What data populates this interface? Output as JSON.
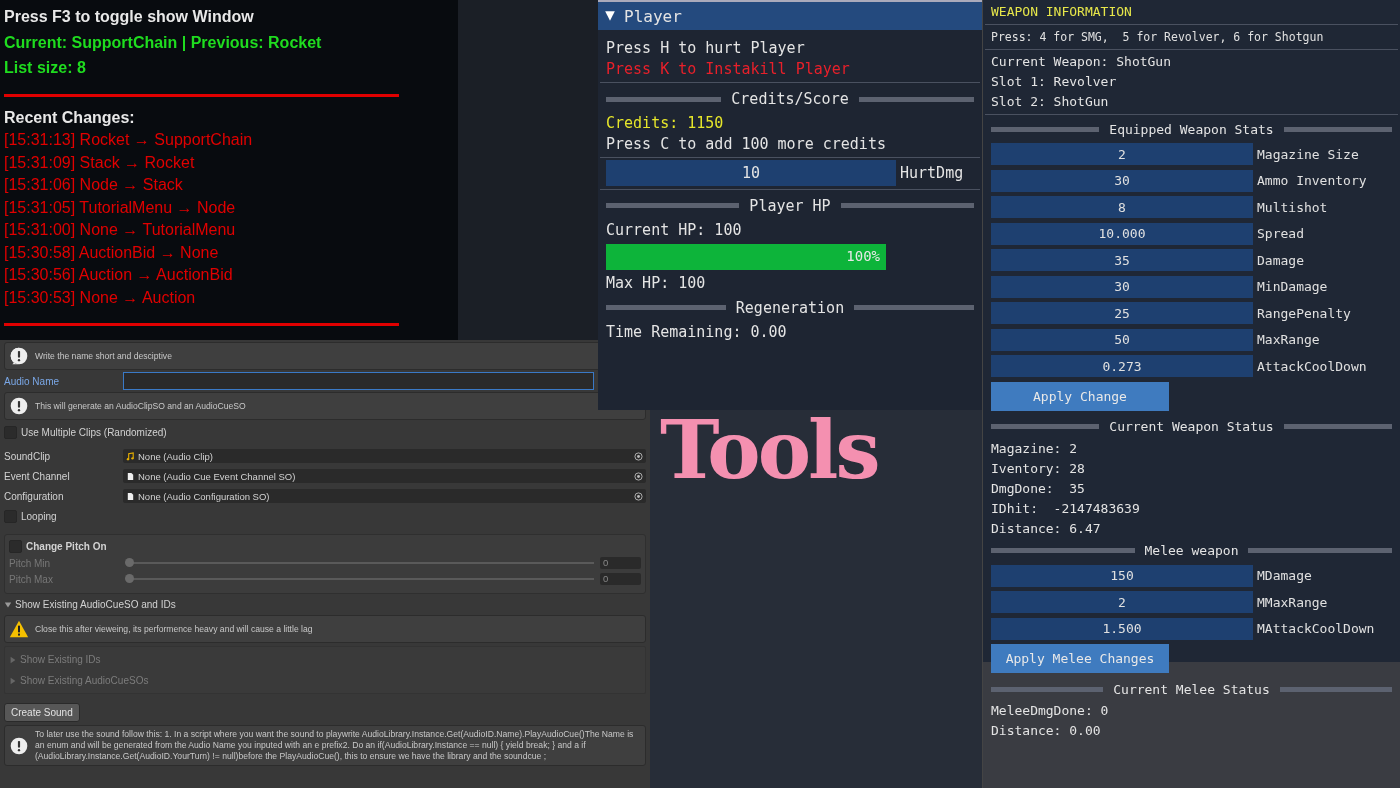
{
  "debug_overlay": {
    "title": "Press F3 to toggle show Window",
    "state_line": "Current: SupportChain | Previous: Rocket",
    "list_size": "List size: 8",
    "recent_heading": "Recent Changes:",
    "changes": [
      "[15:31:13] Rocket → SupportChain",
      "[15:31:09] Stack → Rocket",
      "[15:31:06] Node → Stack",
      "[15:31:05] TutorialMenu → Node",
      "[15:31:00] None → TutorialMenu",
      "[15:30:58] AuctionBid → None",
      "[15:30:56] Auction → AuctionBid",
      "[15:30:53] None → Auction"
    ]
  },
  "inspector": {
    "help_top": "Write the name short and desciptive",
    "audio_name_label": "Audio Name",
    "help_generate": "This will generate an AudioClipSO and an AudioCueSO",
    "multiple_clips": {
      "label": "Use Multiple Clips (Randomized)",
      "checked": false
    },
    "object_fields": [
      {
        "label": "SoundClip",
        "value": "None (Audio Clip)",
        "kind": "audio"
      },
      {
        "label": "Event Channel",
        "value": "None (Audio Cue Event Channel SO)",
        "kind": "asset"
      },
      {
        "label": "Configuration",
        "value": "None (Audio Configuration SO)",
        "kind": "asset"
      }
    ],
    "looping": {
      "label": "Looping",
      "checked": false
    },
    "pitch": {
      "label": "Change Pitch On",
      "checked": false,
      "sliders": [
        {
          "label": "Pitch Min",
          "level": 0,
          "value": "0"
        },
        {
          "label": "Pitch Max",
          "level": 0,
          "value": "0"
        }
      ]
    },
    "foldout": {
      "label": "Show Existing AudioCueSO and IDs",
      "expanded": true,
      "warning": "Close this after vieweing, its performence heavy and will cause a little lag",
      "children": [
        {
          "label": "Show Existing IDs",
          "expanded": false
        },
        {
          "label": "Show Existing AudioCueSOs",
          "expanded": false
        }
      ]
    },
    "create_button": "Create Sound",
    "help_usage": "To later use the sound follow this: 1. In a script where you want the sound to playwrite AudioLibrary.Instance.Get(AudioID.Name).PlayAudioCue()The Name is an enum and will be generated from the Audio Name you inputed with an e prefix2. Do an if(AudioLibrary.Instance == null) { yield break; } and a if (AudioLibrary.Instance.Get(AudioID.YourTurn) != null)before the PlayAudioCue(), this to ensure we have the library and the soundcue ;"
  },
  "player": {
    "title": "Player",
    "expanded": true,
    "items": [
      {
        "kind": "text",
        "text": "Press H to hurt Player"
      },
      {
        "kind": "alert",
        "text": "Press K to Instakill Player"
      },
      {
        "kind": "rule"
      },
      {
        "kind": "heading",
        "text": "Credits/Score"
      },
      {
        "kind": "credit",
        "text": "Credits: 1150"
      },
      {
        "kind": "text",
        "text": "Press C to add 100 more credits"
      },
      {
        "kind": "rule"
      },
      {
        "kind": "input",
        "value": "10",
        "label": "HurtDmg"
      },
      {
        "kind": "rule"
      },
      {
        "kind": "heading",
        "text": "Player HP"
      },
      {
        "kind": "text",
        "text": "Current HP: 100"
      },
      {
        "kind": "progress",
        "level": 1,
        "reading": "100%"
      },
      {
        "kind": "text",
        "text": "Max HP: 100"
      },
      {
        "kind": "heading",
        "text": "Regeneration"
      },
      {
        "kind": "text",
        "text": "Time Remaining: 0.00"
      }
    ]
  },
  "overlay_title": "Tools",
  "weapon": {
    "title": "WEAPON INFORMATION",
    "items": [
      {
        "kind": "rule"
      },
      {
        "kind": "hint",
        "text": "Press: 4 for SMG,  5 for Revolver, 6 for Shotgun"
      },
      {
        "kind": "rule"
      },
      {
        "kind": "text",
        "text": "Current Weapon: ShotGun"
      },
      {
        "kind": "text",
        "text": "Slot 1: Revolver"
      },
      {
        "kind": "text",
        "text": "Slot 2: ShotGun"
      },
      {
        "kind": "rule"
      },
      {
        "kind": "heading",
        "text": "Equipped Weapon Stats"
      },
      {
        "kind": "input",
        "value": "2",
        "label": "Magazine Size"
      },
      {
        "kind": "input",
        "value": "30",
        "label": "Ammo Inventory"
      },
      {
        "kind": "input",
        "value": "8",
        "label": "Multishot"
      },
      {
        "kind": "input",
        "value": "10.000",
        "label": "Spread"
      },
      {
        "kind": "input",
        "value": "35",
        "label": "Damage"
      },
      {
        "kind": "input",
        "value": "30",
        "label": "MinDamage"
      },
      {
        "kind": "input",
        "value": "25",
        "label": "RangePenalty"
      },
      {
        "kind": "input",
        "value": "50",
        "label": "MaxRange"
      },
      {
        "kind": "input",
        "value": "0.273",
        "label": "AttackCoolDown"
      },
      {
        "kind": "button",
        "text": "Apply Change"
      },
      {
        "kind": "heading",
        "text": "Current Weapon Status"
      },
      {
        "kind": "text",
        "text": "Magazine: 2"
      },
      {
        "kind": "text",
        "text": "Iventory: 28"
      },
      {
        "kind": "text",
        "text": "DmgDone:  35"
      },
      {
        "kind": "text",
        "text": "IDhit:  -2147483639"
      },
      {
        "kind": "text",
        "text": "Distance: 6.47"
      },
      {
        "kind": "heading",
        "text": "Melee weapon"
      },
      {
        "kind": "input",
        "value": "150",
        "label": "MDamage"
      },
      {
        "kind": "input",
        "value": "2",
        "label": "MMaxRange"
      },
      {
        "kind": "input",
        "value": "1.500",
        "label": "MAttackCoolDown"
      },
      {
        "kind": "button",
        "text": "Apply Melee Changes"
      },
      {
        "kind": "heading",
        "text": "Current Melee Status"
      },
      {
        "kind": "text",
        "text": "MeleeDmgDone: 0"
      },
      {
        "kind": "text",
        "text": "Distance: 0.00"
      }
    ]
  }
}
